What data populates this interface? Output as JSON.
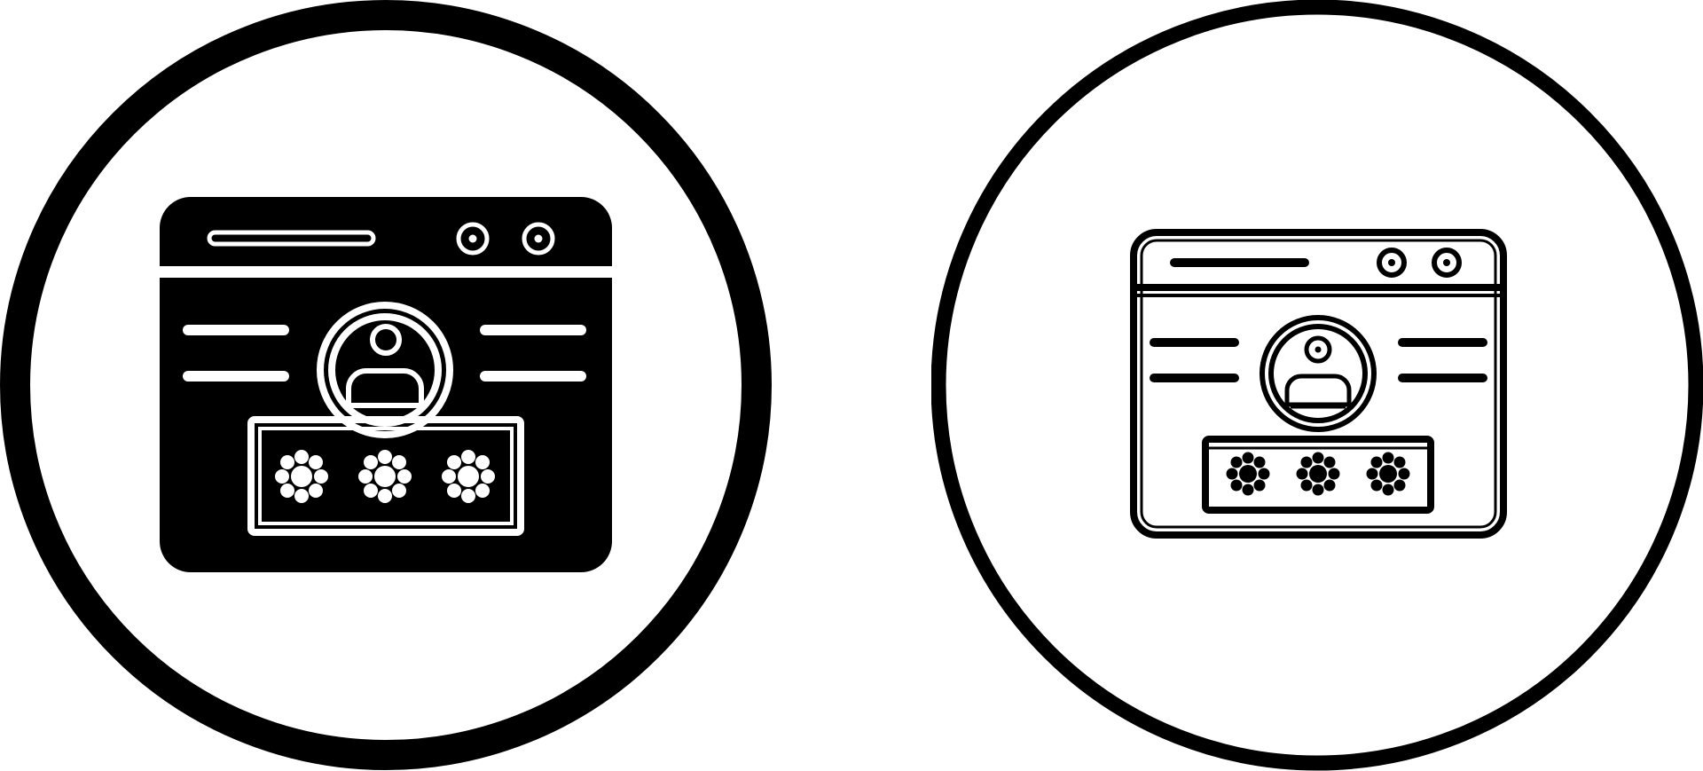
{
  "colors": {
    "ink": "#000000",
    "paper": "#ffffff"
  },
  "icons": [
    {
      "name": "login-browser-icon",
      "style": "glyph",
      "password_mask": [
        "*",
        "*",
        "*"
      ]
    },
    {
      "name": "login-browser-icon",
      "style": "outline",
      "password_mask": [
        "*",
        "*",
        "*"
      ]
    }
  ]
}
